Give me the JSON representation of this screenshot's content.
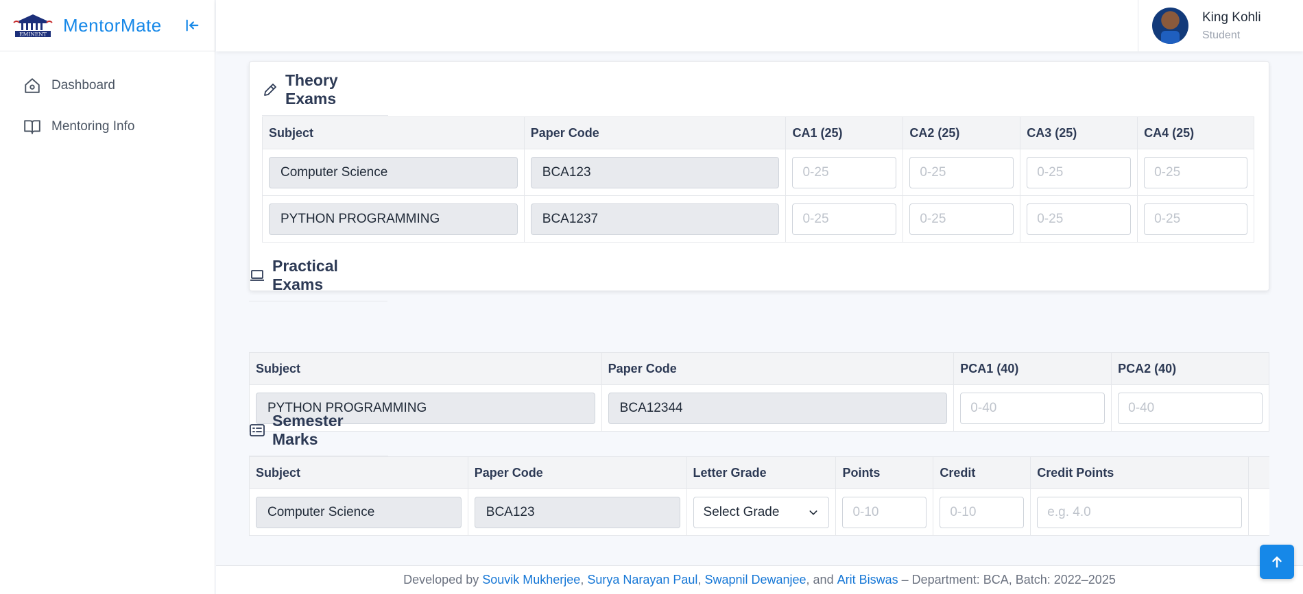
{
  "app": {
    "title": "MentorMate",
    "logo_text": "EMINENT"
  },
  "sidebar": {
    "items": [
      {
        "label": "Dashboard",
        "icon": "home-icon"
      },
      {
        "label": "Mentoring Info",
        "icon": "book-icon"
      }
    ]
  },
  "user": {
    "name": "King Kohli",
    "role": "Student"
  },
  "theory": {
    "title": "Theory Exams",
    "headers": [
      "Subject",
      "Paper Code",
      "CA1 (25)",
      "CA2 (25)",
      "CA3 (25)",
      "CA4 (25)"
    ],
    "rows": [
      {
        "subject": "Computer Science",
        "code": "BCA123"
      },
      {
        "subject": "PYTHON PROGRAMMING",
        "code": "BCA1237"
      }
    ],
    "placeholder": "0-25"
  },
  "practical": {
    "title": "Practical Exams",
    "headers": [
      "Subject",
      "Paper Code",
      "PCA1 (40)",
      "PCA2 (40)"
    ],
    "rows": [
      {
        "subject": "PYTHON PROGRAMMING",
        "code": "BCA12344"
      }
    ],
    "placeholder": "0-40"
  },
  "semester": {
    "title": "Semester Marks",
    "headers": [
      "Subject",
      "Paper Code",
      "Letter Grade",
      "Points",
      "Credit",
      "Credit Points"
    ],
    "rows": [
      {
        "subject": "Computer Science",
        "code": "BCA123",
        "grade": "Select Grade",
        "points_ph": "0-10",
        "credit_ph": "0-10",
        "credit_points_ph": "e.g. 4.0"
      }
    ]
  },
  "footer": {
    "prefix": "Developed by",
    "dev1": "Souvik Mukherjee",
    "dev2": "Surya Narayan Paul",
    "dev3": "Swapnil Dewanjee",
    "and": ", and",
    "dev4": "Arit Biswas",
    "suffix": "– Department: BCA, Batch: 2022–2025"
  },
  "colors": {
    "accent": "#1688e8",
    "heading": "#2d3a55"
  }
}
